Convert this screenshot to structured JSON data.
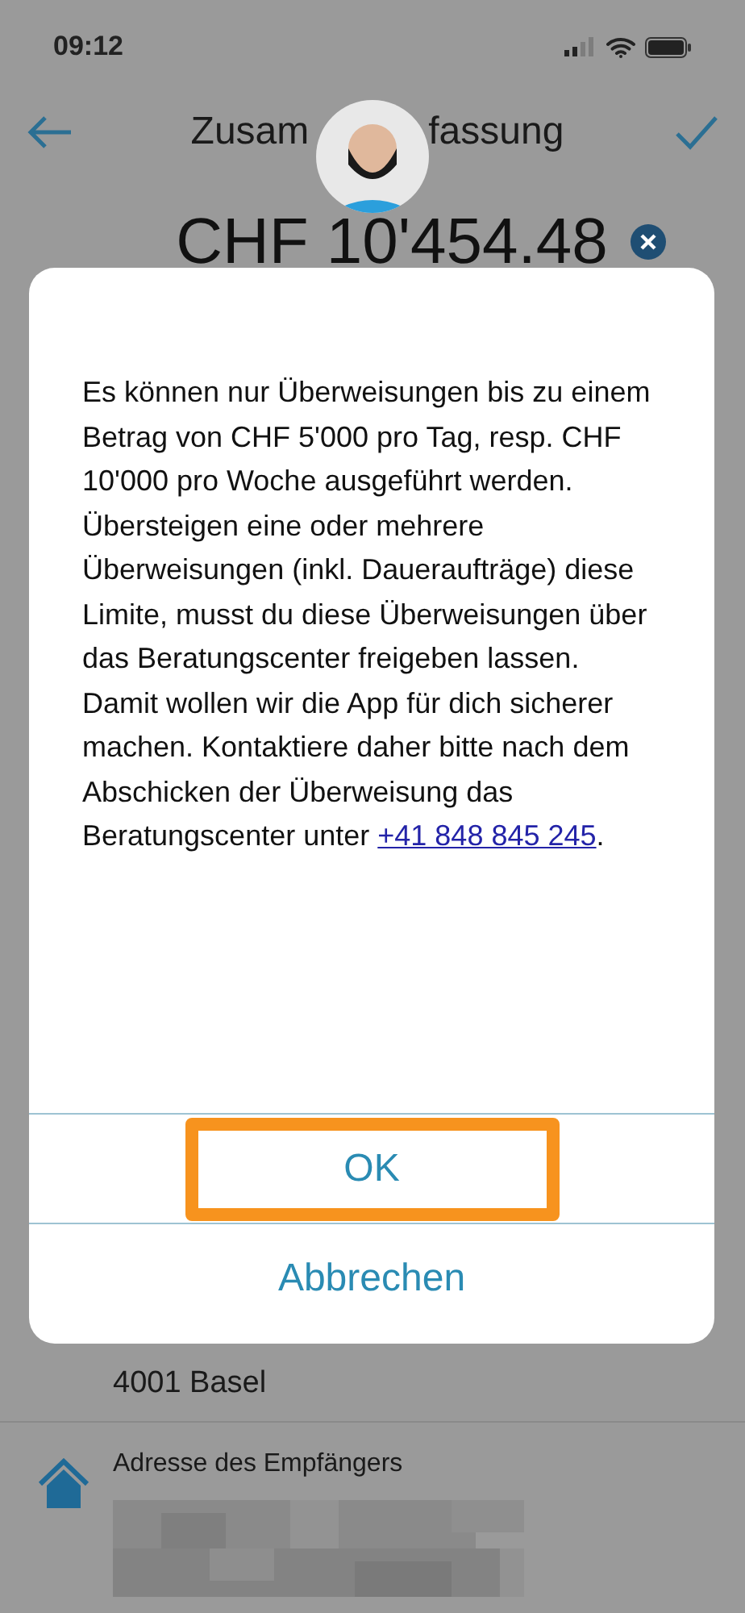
{
  "status_bar": {
    "time": "09:12"
  },
  "header": {
    "title_parts": [
      "Zusam",
      "fassung"
    ],
    "amount": "CHF 10'454.48"
  },
  "background": {
    "city": "4001 Basel",
    "address_label": "Adresse des Empfängers"
  },
  "dialog": {
    "message": "Es können nur Überweisungen bis zu einem Betrag von CHF 5'000 pro Tag, resp. CHF 10'000 pro Woche ausgeführt werden. Übersteigen eine oder mehrere Überweisungen (inkl. Daueraufträge) diese Limite, musst du diese Überweisungen über das Beratungscenter freigeben lassen. Damit wollen wir die App für dich sicherer machen. Kontaktiere daher bitte nach dem Abschicken der Überweisung das Beratungscenter unter",
    "phone_link": "+41 848 845 245",
    "message_end": ".",
    "buttons": [
      {
        "label": "OK",
        "highlighted": true
      },
      {
        "label": "Abbrechen",
        "highlighted": false
      }
    ]
  }
}
